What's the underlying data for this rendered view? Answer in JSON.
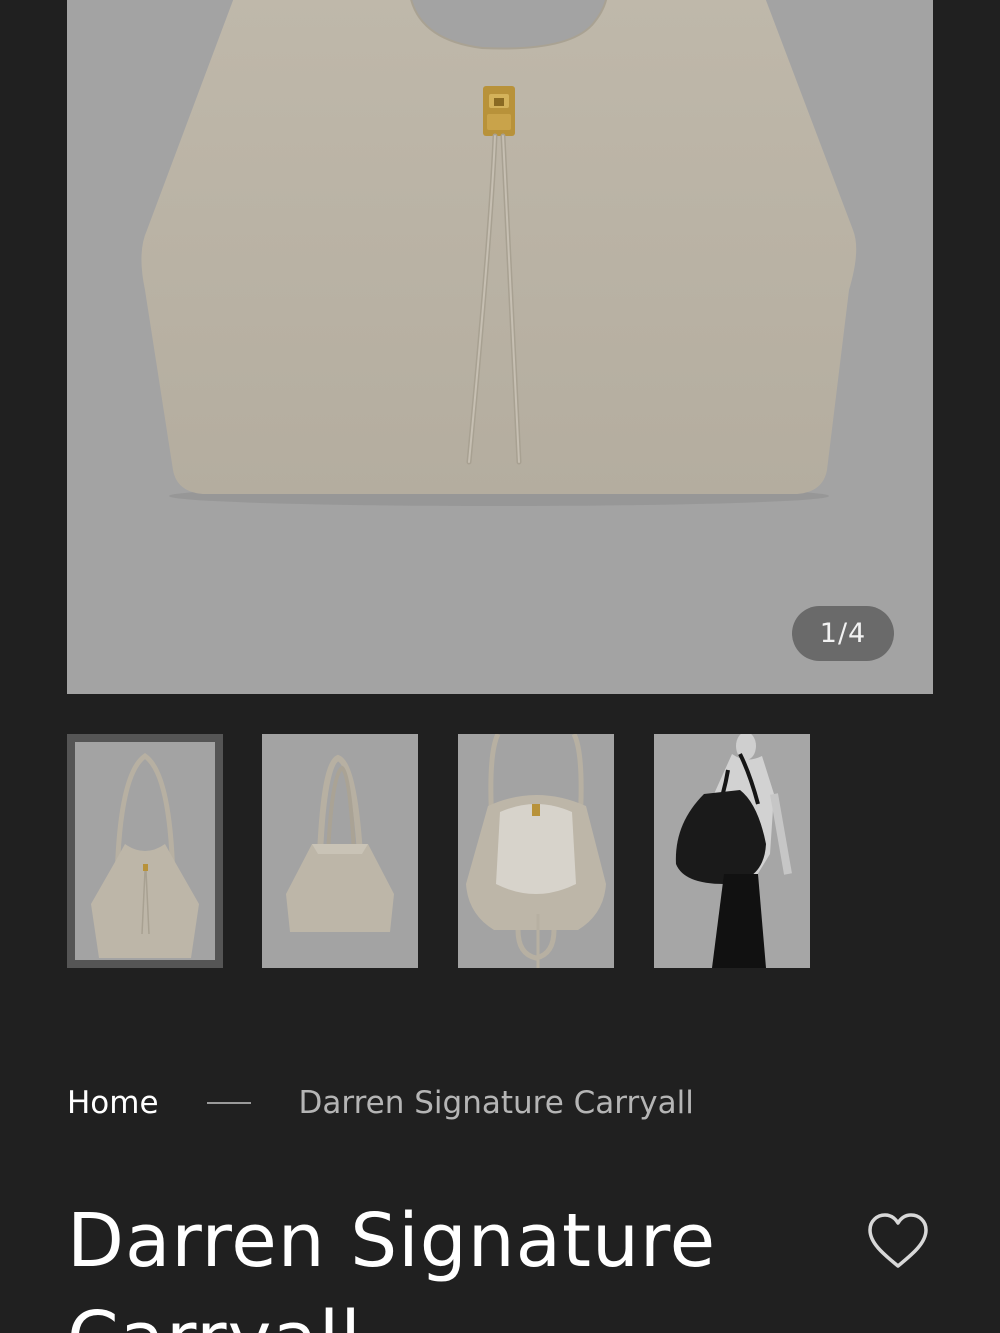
{
  "gallery": {
    "counter": "1/4",
    "thumbnails": [
      {
        "name": "front view",
        "active": true
      },
      {
        "name": "side view",
        "active": false
      },
      {
        "name": "open interior view",
        "active": false
      },
      {
        "name": "worn on model",
        "active": false
      }
    ]
  },
  "breadcrumb": {
    "home": "Home",
    "current": "Darren Signature Carryall"
  },
  "product": {
    "title": "Darren Signature Carryall"
  },
  "icons": {
    "wishlist": "heart-outline-icon"
  },
  "colors": {
    "background": "#202020",
    "image_background": "#a3a3a3",
    "bag_color": "#bdb6a8",
    "hardware_gold": "#b8923a"
  }
}
